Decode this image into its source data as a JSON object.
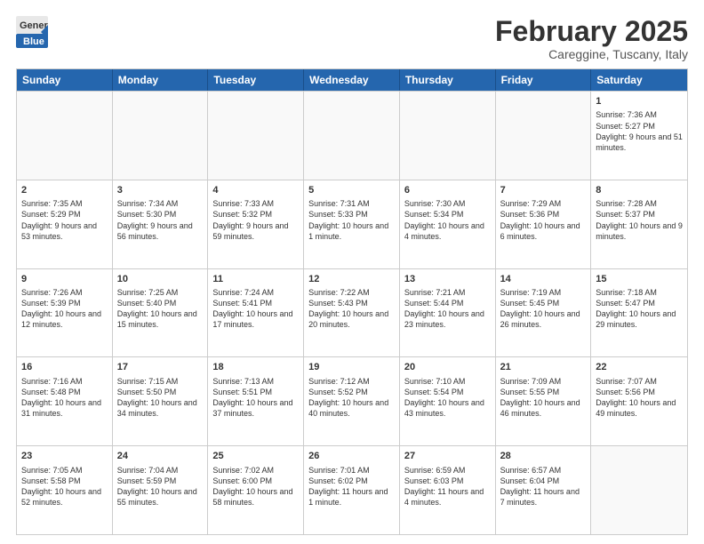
{
  "header": {
    "logo_line1": "General",
    "logo_line2": "Blue",
    "month": "February 2025",
    "location": "Careggine, Tuscany, Italy"
  },
  "weekdays": [
    "Sunday",
    "Monday",
    "Tuesday",
    "Wednesday",
    "Thursday",
    "Friday",
    "Saturday"
  ],
  "rows": [
    [
      {
        "day": "",
        "info": ""
      },
      {
        "day": "",
        "info": ""
      },
      {
        "day": "",
        "info": ""
      },
      {
        "day": "",
        "info": ""
      },
      {
        "day": "",
        "info": ""
      },
      {
        "day": "",
        "info": ""
      },
      {
        "day": "1",
        "info": "Sunrise: 7:36 AM\nSunset: 5:27 PM\nDaylight: 9 hours and 51 minutes."
      }
    ],
    [
      {
        "day": "2",
        "info": "Sunrise: 7:35 AM\nSunset: 5:29 PM\nDaylight: 9 hours and 53 minutes."
      },
      {
        "day": "3",
        "info": "Sunrise: 7:34 AM\nSunset: 5:30 PM\nDaylight: 9 hours and 56 minutes."
      },
      {
        "day": "4",
        "info": "Sunrise: 7:33 AM\nSunset: 5:32 PM\nDaylight: 9 hours and 59 minutes."
      },
      {
        "day": "5",
        "info": "Sunrise: 7:31 AM\nSunset: 5:33 PM\nDaylight: 10 hours and 1 minute."
      },
      {
        "day": "6",
        "info": "Sunrise: 7:30 AM\nSunset: 5:34 PM\nDaylight: 10 hours and 4 minutes."
      },
      {
        "day": "7",
        "info": "Sunrise: 7:29 AM\nSunset: 5:36 PM\nDaylight: 10 hours and 6 minutes."
      },
      {
        "day": "8",
        "info": "Sunrise: 7:28 AM\nSunset: 5:37 PM\nDaylight: 10 hours and 9 minutes."
      }
    ],
    [
      {
        "day": "9",
        "info": "Sunrise: 7:26 AM\nSunset: 5:39 PM\nDaylight: 10 hours and 12 minutes."
      },
      {
        "day": "10",
        "info": "Sunrise: 7:25 AM\nSunset: 5:40 PM\nDaylight: 10 hours and 15 minutes."
      },
      {
        "day": "11",
        "info": "Sunrise: 7:24 AM\nSunset: 5:41 PM\nDaylight: 10 hours and 17 minutes."
      },
      {
        "day": "12",
        "info": "Sunrise: 7:22 AM\nSunset: 5:43 PM\nDaylight: 10 hours and 20 minutes."
      },
      {
        "day": "13",
        "info": "Sunrise: 7:21 AM\nSunset: 5:44 PM\nDaylight: 10 hours and 23 minutes."
      },
      {
        "day": "14",
        "info": "Sunrise: 7:19 AM\nSunset: 5:45 PM\nDaylight: 10 hours and 26 minutes."
      },
      {
        "day": "15",
        "info": "Sunrise: 7:18 AM\nSunset: 5:47 PM\nDaylight: 10 hours and 29 minutes."
      }
    ],
    [
      {
        "day": "16",
        "info": "Sunrise: 7:16 AM\nSunset: 5:48 PM\nDaylight: 10 hours and 31 minutes."
      },
      {
        "day": "17",
        "info": "Sunrise: 7:15 AM\nSunset: 5:50 PM\nDaylight: 10 hours and 34 minutes."
      },
      {
        "day": "18",
        "info": "Sunrise: 7:13 AM\nSunset: 5:51 PM\nDaylight: 10 hours and 37 minutes."
      },
      {
        "day": "19",
        "info": "Sunrise: 7:12 AM\nSunset: 5:52 PM\nDaylight: 10 hours and 40 minutes."
      },
      {
        "day": "20",
        "info": "Sunrise: 7:10 AM\nSunset: 5:54 PM\nDaylight: 10 hours and 43 minutes."
      },
      {
        "day": "21",
        "info": "Sunrise: 7:09 AM\nSunset: 5:55 PM\nDaylight: 10 hours and 46 minutes."
      },
      {
        "day": "22",
        "info": "Sunrise: 7:07 AM\nSunset: 5:56 PM\nDaylight: 10 hours and 49 minutes."
      }
    ],
    [
      {
        "day": "23",
        "info": "Sunrise: 7:05 AM\nSunset: 5:58 PM\nDaylight: 10 hours and 52 minutes."
      },
      {
        "day": "24",
        "info": "Sunrise: 7:04 AM\nSunset: 5:59 PM\nDaylight: 10 hours and 55 minutes."
      },
      {
        "day": "25",
        "info": "Sunrise: 7:02 AM\nSunset: 6:00 PM\nDaylight: 10 hours and 58 minutes."
      },
      {
        "day": "26",
        "info": "Sunrise: 7:01 AM\nSunset: 6:02 PM\nDaylight: 11 hours and 1 minute."
      },
      {
        "day": "27",
        "info": "Sunrise: 6:59 AM\nSunset: 6:03 PM\nDaylight: 11 hours and 4 minutes."
      },
      {
        "day": "28",
        "info": "Sunrise: 6:57 AM\nSunset: 6:04 PM\nDaylight: 11 hours and 7 minutes."
      },
      {
        "day": "",
        "info": ""
      }
    ]
  ]
}
